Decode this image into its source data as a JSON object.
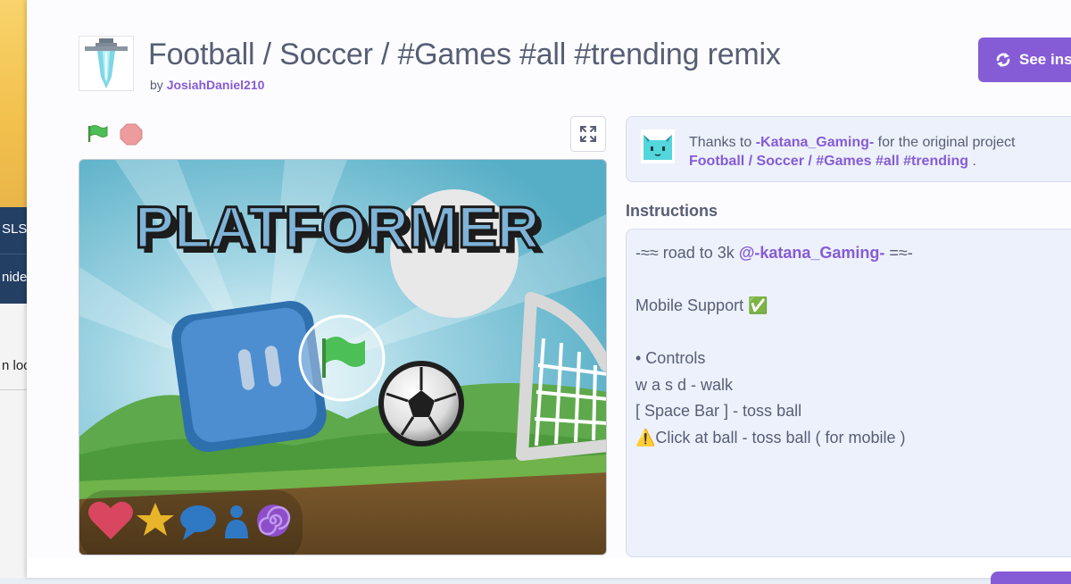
{
  "background_window": {
    "labels": [
      "SLS",
      "nide",
      "n loc"
    ]
  },
  "project": {
    "title": "Football / Soccer / #Games #all #trending remix",
    "by_prefix": "by",
    "author": "JosiahDaniel210",
    "see_inside_label": "See ins"
  },
  "stage": {
    "game_title": "PLATFORMER"
  },
  "credit": {
    "prefix": "Thanks to",
    "original_author": "-Katana_Gaming-",
    "middle": "for the original project",
    "original_project": "Football / Soccer / #Games #all #trending",
    "suffix": "."
  },
  "instructions": {
    "heading": "Instructions",
    "lines": [
      {
        "pre": "-≈≈ road to 3k ",
        "mention": "@-katana_Gaming-",
        "post": " =≈-"
      },
      {
        "pre": "",
        "mention": "",
        "post": ""
      },
      {
        "pre": "Mobile Support ✅",
        "mention": "",
        "post": ""
      },
      {
        "pre": "",
        "mention": "",
        "post": ""
      },
      {
        "pre": "• Controls",
        "mention": "",
        "post": ""
      },
      {
        "pre": "w a s d - walk",
        "mention": "",
        "post": ""
      },
      {
        "pre": "[ Space Bar ] - toss ball",
        "mention": "",
        "post": ""
      },
      {
        "pre": "⚠️Click at ball - toss ball ( for mobile )",
        "mention": "",
        "post": ""
      }
    ]
  },
  "colors": {
    "accent": "#855cd6",
    "text": "#575e75",
    "green_flag": "#4cbf56",
    "stop": "#ec9c9c"
  },
  "icons": [
    "sword-icon",
    "green-flag-icon",
    "stop-icon",
    "fullscreen-icon",
    "remix-icon",
    "cat-avatar-icon",
    "heart-icon",
    "star-icon",
    "comment-icon",
    "person-icon",
    "spiral-icon"
  ]
}
